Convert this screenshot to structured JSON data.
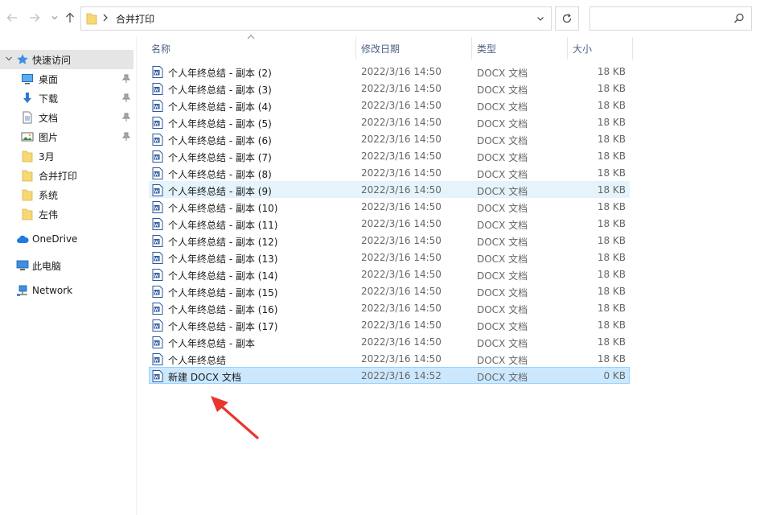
{
  "address": {
    "path": "合并打印"
  },
  "search": {
    "placeholder": ""
  },
  "nav": {
    "quick_access": "快速访问",
    "pinned": [
      {
        "label": "桌面",
        "icon": "desktop-icon"
      },
      {
        "label": "下载",
        "icon": "download-icon"
      },
      {
        "label": "文档",
        "icon": "document-icon"
      },
      {
        "label": "图片",
        "icon": "pictures-icon"
      }
    ],
    "folders": [
      "3月",
      "合并打印",
      "系统",
      "左伟"
    ],
    "onedrive": "OneDrive",
    "this_pc": "此电脑",
    "network": "Network"
  },
  "columns": {
    "name": "名称",
    "date": "修改日期",
    "type": "类型",
    "size": "大小"
  },
  "files": [
    {
      "name": "个人年终总结 - 副本 (2)",
      "date": "2022/3/16 14:50",
      "type": "DOCX 文档",
      "size": "18 KB"
    },
    {
      "name": "个人年终总结 - 副本 (3)",
      "date": "2022/3/16 14:50",
      "type": "DOCX 文档",
      "size": "18 KB"
    },
    {
      "name": "个人年终总结 - 副本 (4)",
      "date": "2022/3/16 14:50",
      "type": "DOCX 文档",
      "size": "18 KB"
    },
    {
      "name": "个人年终总结 - 副本 (5)",
      "date": "2022/3/16 14:50",
      "type": "DOCX 文档",
      "size": "18 KB"
    },
    {
      "name": "个人年终总结 - 副本 (6)",
      "date": "2022/3/16 14:50",
      "type": "DOCX 文档",
      "size": "18 KB"
    },
    {
      "name": "个人年终总结 - 副本 (7)",
      "date": "2022/3/16 14:50",
      "type": "DOCX 文档",
      "size": "18 KB"
    },
    {
      "name": "个人年终总结 - 副本 (8)",
      "date": "2022/3/16 14:50",
      "type": "DOCX 文档",
      "size": "18 KB"
    },
    {
      "name": "个人年终总结 - 副本 (9)",
      "date": "2022/3/16 14:50",
      "type": "DOCX 文档",
      "size": "18 KB"
    },
    {
      "name": "个人年终总结 - 副本 (10)",
      "date": "2022/3/16 14:50",
      "type": "DOCX 文档",
      "size": "18 KB"
    },
    {
      "name": "个人年终总结 - 副本 (11)",
      "date": "2022/3/16 14:50",
      "type": "DOCX 文档",
      "size": "18 KB"
    },
    {
      "name": "个人年终总结 - 副本 (12)",
      "date": "2022/3/16 14:50",
      "type": "DOCX 文档",
      "size": "18 KB"
    },
    {
      "name": "个人年终总结 - 副本 (13)",
      "date": "2022/3/16 14:50",
      "type": "DOCX 文档",
      "size": "18 KB"
    },
    {
      "name": "个人年终总结 - 副本 (14)",
      "date": "2022/3/16 14:50",
      "type": "DOCX 文档",
      "size": "18 KB"
    },
    {
      "name": "个人年终总结 - 副本 (15)",
      "date": "2022/3/16 14:50",
      "type": "DOCX 文档",
      "size": "18 KB"
    },
    {
      "name": "个人年终总结 - 副本 (16)",
      "date": "2022/3/16 14:50",
      "type": "DOCX 文档",
      "size": "18 KB"
    },
    {
      "name": "个人年终总结 - 副本 (17)",
      "date": "2022/3/16 14:50",
      "type": "DOCX 文档",
      "size": "18 KB"
    },
    {
      "name": "个人年终总结 - 副本",
      "date": "2022/3/16 14:50",
      "type": "DOCX 文档",
      "size": "18 KB"
    },
    {
      "name": "个人年终总结",
      "date": "2022/3/16 14:50",
      "type": "DOCX 文档",
      "size": "18 KB"
    },
    {
      "name": "新建 DOCX 文档",
      "date": "2022/3/16 14:52",
      "type": "DOCX 文档",
      "size": "0 KB"
    }
  ],
  "hovered_index": 7,
  "selected_index": 18,
  "colors": {
    "selected_bg": "#cce8ff",
    "hover_bg": "#e5f3fb",
    "folder": "#f8d775",
    "word_blue": "#2b579a",
    "annotation_arrow": "#e8362f"
  }
}
